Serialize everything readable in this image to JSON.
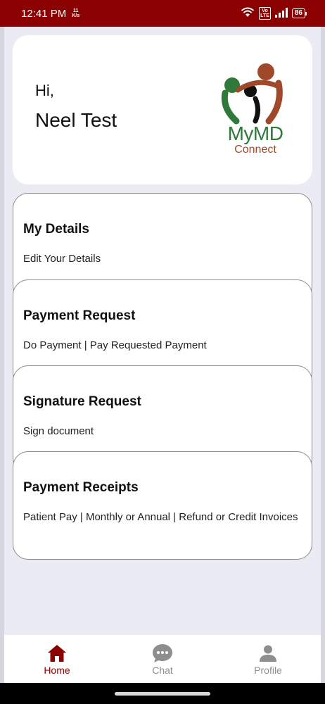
{
  "status_bar": {
    "time": "12:41 PM",
    "speed_value": "11",
    "speed_unit": "K/s",
    "volte_top": "Vo",
    "volte_bottom": "LTE",
    "battery": "86"
  },
  "header": {
    "greeting": "Hi,",
    "user_name": "Neel Test",
    "logo_main": "MyMD",
    "logo_sub": "Connect"
  },
  "menu": [
    {
      "title": "My Details",
      "subtitle": "Edit Your Details"
    },
    {
      "title": "Payment Request",
      "subtitle": "Do Payment | Pay Requested Payment"
    },
    {
      "title": "Signature Request",
      "subtitle": "Sign document"
    },
    {
      "title": "Payment Receipts",
      "subtitle": "Patient Pay | Monthly or Annual | Refund or Credit Invoices"
    }
  ],
  "bottom_nav": [
    {
      "label": "Home",
      "icon": "home-icon",
      "active": true
    },
    {
      "label": "Chat",
      "icon": "chat-icon",
      "active": false
    },
    {
      "label": "Profile",
      "icon": "profile-icon",
      "active": false
    }
  ],
  "colors": {
    "brand": "#8b0000",
    "logo_green": "#2f7a3a",
    "logo_brown": "#a0492a",
    "inactive": "#8e8e8e"
  }
}
